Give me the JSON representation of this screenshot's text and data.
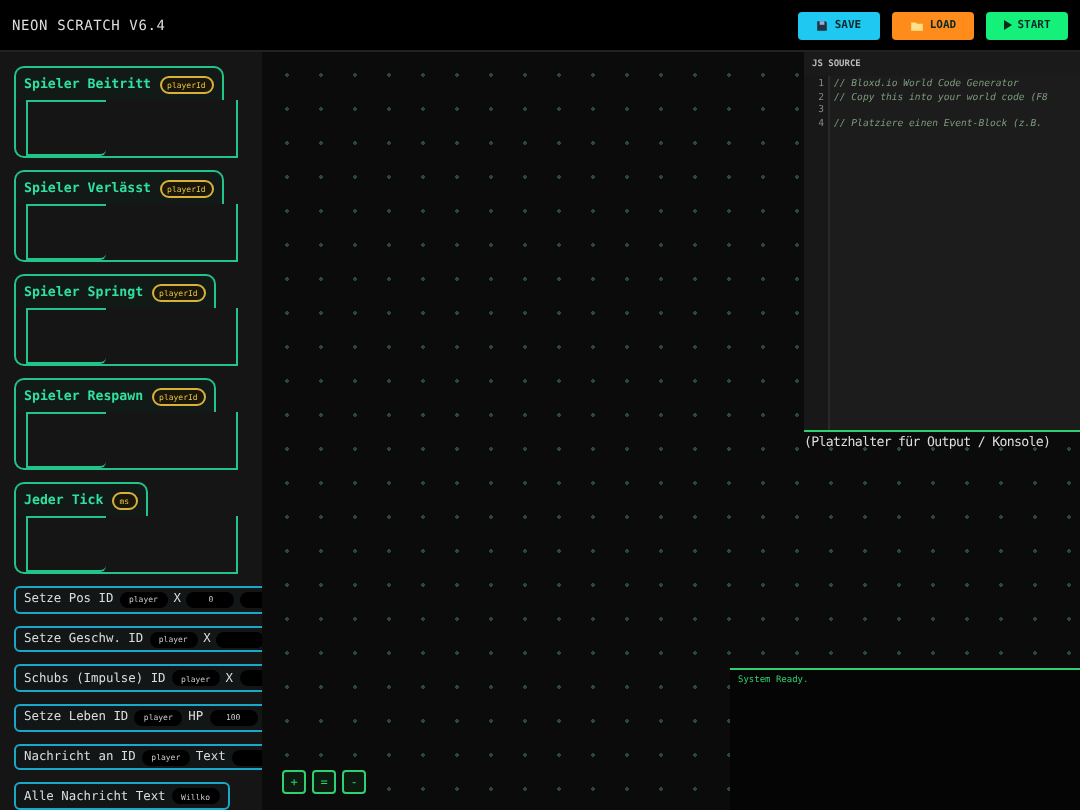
{
  "app": {
    "title": "NEON SCRATCH V6.4"
  },
  "toolbar": [
    {
      "kind": "save",
      "label": "SAVE"
    },
    {
      "kind": "load",
      "label": "LOAD"
    },
    {
      "kind": "start",
      "label": "START"
    }
  ],
  "palette": [
    {
      "kind": "event",
      "label": "Spieler Beitritt",
      "params": [
        {
          "kind": "pill",
          "text": "playerId"
        }
      ]
    },
    {
      "kind": "event",
      "label": "Spieler Verlässt",
      "params": [
        {
          "kind": "pill",
          "text": "playerId"
        }
      ]
    },
    {
      "kind": "event",
      "label": "Spieler Springt",
      "params": [
        {
          "kind": "pill",
          "text": "playerId"
        }
      ]
    },
    {
      "kind": "event",
      "label": "Spieler Respawn",
      "params": [
        {
          "kind": "pill",
          "text": "playerId"
        }
      ]
    },
    {
      "kind": "event",
      "label": "Jeder Tick",
      "params": [
        {
          "kind": "pill",
          "text": "ms"
        }
      ]
    },
    {
      "kind": "action",
      "label": "Setze Pos ID",
      "params": [
        {
          "kind": "input",
          "text": "player"
        },
        {
          "kind": "word",
          "text": "X"
        },
        {
          "kind": "input",
          "text": "0"
        },
        {
          "kind": "input"
        }
      ]
    },
    {
      "kind": "action",
      "label": "Setze Geschw. ID",
      "params": [
        {
          "kind": "input",
          "text": "player"
        },
        {
          "kind": "word",
          "text": "X"
        },
        {
          "kind": "input"
        }
      ]
    },
    {
      "kind": "action",
      "label": "Schubs (Impulse) ID",
      "params": [
        {
          "kind": "input",
          "text": "player"
        },
        {
          "kind": "word",
          "text": "X"
        },
        {
          "kind": "input"
        }
      ]
    },
    {
      "kind": "action",
      "label": "Setze Leben ID",
      "params": [
        {
          "kind": "input",
          "text": "player"
        },
        {
          "kind": "word",
          "text": "HP"
        },
        {
          "kind": "input",
          "text": "100"
        }
      ]
    },
    {
      "kind": "action",
      "label": "Nachricht an ID",
      "params": [
        {
          "kind": "input",
          "text": "player"
        },
        {
          "kind": "word",
          "text": "Text"
        },
        {
          "kind": "input"
        }
      ]
    },
    {
      "kind": "action",
      "label": "Alle Nachricht Text",
      "params": [
        {
          "kind": "input",
          "text": "Willko"
        }
      ]
    }
  ],
  "code_panel": {
    "title": "JS SOURCE",
    "lines": [
      {
        "number": "1",
        "text": "// Bloxd.io World Code Generator"
      },
      {
        "number": "2",
        "text": "// Copy this into your world code (F8"
      },
      {
        "number": "3"
      },
      {
        "number": "4",
        "text": "// Platziere einen Event-Block (z.B."
      }
    ]
  },
  "output": {
    "placeholder": "(Platzhalter für Output / Konsole)"
  },
  "console": {
    "lines": [
      "System Ready."
    ]
  },
  "zoom_controls": [
    {
      "label": "+"
    },
    {
      "label": "="
    },
    {
      "label": "-"
    }
  ]
}
